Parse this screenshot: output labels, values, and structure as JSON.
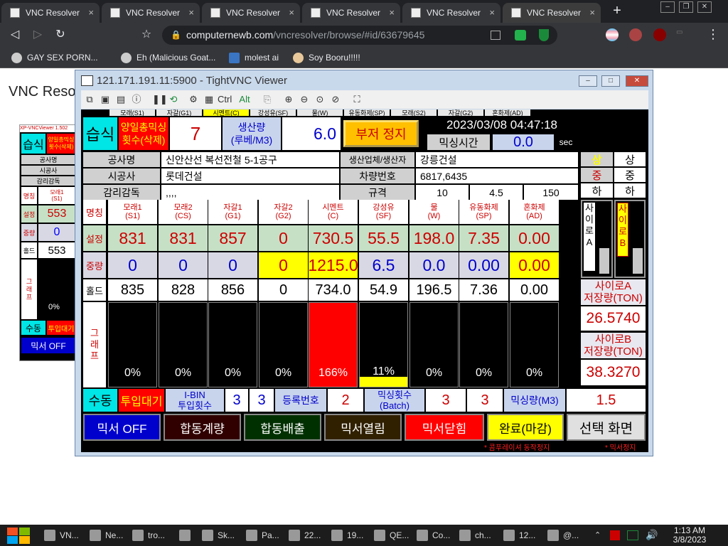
{
  "browser": {
    "tabs": [
      {
        "title": "VNC Resolver"
      },
      {
        "title": "VNC Resolver"
      },
      {
        "title": "VNC Resolver"
      },
      {
        "title": "VNC Resolver"
      },
      {
        "title": "VNC Resolver"
      },
      {
        "title": "VNC Resolver"
      }
    ],
    "url_domain": "computernewb.com",
    "url_path": "/vncresolver/browse/#id/63679645",
    "bookmarks": [
      "GAY SEX PORN...",
      "Eh (Malicious Goat...",
      "molest ai",
      "Soy Booru!!!!!"
    ]
  },
  "page": {
    "title": "VNC Resol",
    "mini": {
      "title": "XP-VNCViewer 1.502",
      "wet": "습식",
      "count": "양일총믹싱\n횟수(삭제)",
      "r1": "공사명",
      "r2": "시공사",
      "r3": "감리감독",
      "name": "명칭",
      "sand": "모래1\n(S1)",
      "set": "설정",
      "setv": "553",
      "mid": "중량",
      "midv": "0",
      "hold": "홀드",
      "holdv": "553",
      "graph": "그\n래\n프",
      "pct": "0%",
      "manual": "수동",
      "wait": "투입대기",
      "mixoff": "믹서 OFF"
    }
  },
  "vnc": {
    "title": "121.171.191.11:5900 - TightVNC Viewer",
    "toolbar_ctrl": "Ctrl",
    "toolbar_alt": "Alt"
  },
  "hmi": {
    "top_tabs": [
      "모래(S1)",
      "자갈(G1)",
      "시멘트(C)",
      "강성유(SF)",
      "물(W)",
      "유동화제(SP)",
      "모래(S2)",
      "자갈(G2)",
      "혼화제(AD)"
    ],
    "wet": "습식",
    "daily_count_label": "양일총믹싱\n횟수(삭제)",
    "daily_count": "7",
    "production_label": "생산량\n(루베/M3)",
    "production": "6.0",
    "buzzer_stop": "부저 정지",
    "datetime": "2023/03/08 04:47:18",
    "mix_time_label": "믹싱시간",
    "mix_time": "0.0",
    "sec": "sec",
    "project_label": "공사명",
    "project": "신안산선 복선전철 5-1공구",
    "maker_label": "생산업체/생산자",
    "maker": "강릉건설",
    "contractor_label": "시공사",
    "contractor": "롯데건설",
    "vehicle_label": "차량번호",
    "vehicle": "6817,6435",
    "supervisor_label": "감리감독",
    "supervisor": ",,,,",
    "spec_label": "규격",
    "spec": [
      "10",
      "4.5",
      "150"
    ],
    "grade_labels": [
      "상",
      "중",
      "하"
    ],
    "grade_values": [
      "상",
      "중",
      "하"
    ],
    "name_label": "명칭",
    "columns": [
      {
        "name": "모래1",
        "code": "(S1)",
        "set": "831",
        "weight": "0",
        "hold": "835",
        "pct": "0%",
        "fill": 0
      },
      {
        "name": "모래2",
        "code": "(CS)",
        "set": "831",
        "weight": "0",
        "hold": "828",
        "pct": "0%",
        "fill": 0
      },
      {
        "name": "자갈1",
        "code": "(G1)",
        "set": "857",
        "weight": "0",
        "hold": "856",
        "pct": "0%",
        "fill": 0
      },
      {
        "name": "자갈2",
        "code": "(G2)",
        "set": "0",
        "weight": "0",
        "hold": "0",
        "pct": "0%",
        "fill": 0
      },
      {
        "name": "시멘트",
        "code": "(C)",
        "set": "730.5",
        "weight": "1215.0",
        "hold": "734.0",
        "pct": "166%",
        "fill": 1.0
      },
      {
        "name": "강성유",
        "code": "(SF)",
        "set": "55.5",
        "weight": "6.5",
        "hold": "54.9",
        "pct": "11%",
        "fill": 0.11
      },
      {
        "name": "물",
        "code": "(W)",
        "set": "198.0",
        "weight": "0.0",
        "hold": "196.5",
        "pct": "0%",
        "fill": 0
      },
      {
        "name": "유동화제",
        "code": "(SP)",
        "set": "7.35",
        "weight": "0.00",
        "hold": "7.36",
        "pct": "0%",
        "fill": 0
      },
      {
        "name": "혼화제",
        "code": "(AD)",
        "set": "0.00",
        "weight": "0.00",
        "hold": "0.00",
        "pct": "0%",
        "fill": 0
      }
    ],
    "set_label": "설정",
    "weight_label": "중량",
    "hold_label": "홀드",
    "graph_label": "그\n래\n프",
    "siloA_label": "사\n이\n로\nA",
    "siloB_label": "사\n이\n로\nB",
    "siloA_storage_label": "사이로A\n저장량(TON)",
    "siloA_storage": "26.5740",
    "siloB_storage_label": "사이로B\n저장량(TON)",
    "siloB_storage": "38.3270",
    "manual": "수동",
    "wait": "투입대기",
    "ibin_label": "I-BIN\n투입횟수",
    "ibin1": "3",
    "ibin2": "3",
    "reg_label": "등록번호",
    "reg": "2",
    "mix_count_label": "믹싱횟수\n(Batch)",
    "mix_count1": "3",
    "mix_count2": "3",
    "mix_amount_label": "믹싱량(M3)",
    "mix_amount": "1.5",
    "buttons": [
      "믹서 OFF",
      "합동계량",
      "합동배출",
      "믹서열림",
      "믹서닫힘",
      "완료(마감)",
      "선택 화면"
    ],
    "note1": "* 콤푸레이셔 동작정지",
    "note2": "* 믹서정지"
  },
  "taskbar": {
    "items": [
      "VN...",
      "Ne...",
      "tro...",
      "",
      "Sk...",
      "Pa...",
      "22...",
      "19...",
      "QE...",
      "Co...",
      "ch...",
      "12...",
      "@..."
    ],
    "time": "1:13 AM",
    "date": "3/8/2023"
  },
  "colors": {
    "accent_red": "#ff0000",
    "accent_yellow": "#ffff00",
    "hmi_bg": "#000000"
  }
}
